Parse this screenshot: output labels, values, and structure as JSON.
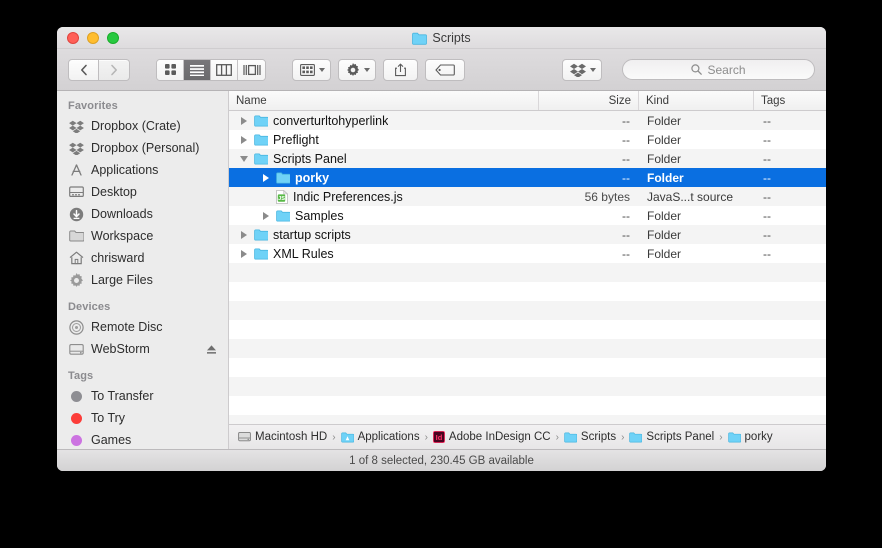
{
  "window": {
    "title": "Scripts",
    "title_icon": "folder-icon",
    "traffic_lights": [
      "close-button",
      "minimize-button",
      "maximize-button"
    ]
  },
  "toolbar": {
    "back_label": "‹",
    "forward_label": "›",
    "view_modes": [
      {
        "name": "icon-view",
        "active": false
      },
      {
        "name": "list-view",
        "active": true
      },
      {
        "name": "column-view",
        "active": false
      },
      {
        "name": "gallery-view",
        "active": false
      }
    ],
    "arrange_button": "arrange-button",
    "action_button": "action-gear-button",
    "share_button": "share-button",
    "tag_button": "tag-button",
    "dropbox_button": "dropbox-button",
    "search": {
      "placeholder": "Search",
      "value": ""
    }
  },
  "sidebar": {
    "sections": [
      {
        "header": "Favorites",
        "items": [
          {
            "label": "Dropbox (Crate)",
            "icon": "dropbox-icon"
          },
          {
            "label": "Dropbox (Personal)",
            "icon": "dropbox-icon"
          },
          {
            "label": "Applications",
            "icon": "applications-icon"
          },
          {
            "label": "Desktop",
            "icon": "desktop-icon"
          },
          {
            "label": "Downloads",
            "icon": "downloads-icon"
          },
          {
            "label": "Workspace",
            "icon": "folder-icon"
          },
          {
            "label": "chrisward",
            "icon": "home-icon"
          },
          {
            "label": "Large Files",
            "icon": "gear-icon"
          }
        ]
      },
      {
        "header": "Devices",
        "items": [
          {
            "label": "Remote Disc",
            "icon": "disc-icon"
          },
          {
            "label": "WebStorm",
            "icon": "drive-icon",
            "eject": true
          }
        ]
      },
      {
        "header": "Tags",
        "items": [
          {
            "label": "To Transfer",
            "icon": "tag-dot",
            "color": "#8e8e93"
          },
          {
            "label": "To Try",
            "icon": "tag-dot",
            "color": "#fc3d39"
          },
          {
            "label": "Games",
            "icon": "tag-dot",
            "color": "#cc73e1"
          }
        ]
      }
    ]
  },
  "file_list": {
    "columns": [
      "Name",
      "Size",
      "Kind",
      "Tags"
    ],
    "rows": [
      {
        "name": "converturltohyperlink",
        "size": "--",
        "kind": "Folder",
        "tags": "--",
        "depth": 0,
        "icon": "folder-icon",
        "twisty": "closed",
        "selected": false
      },
      {
        "name": "Preflight",
        "size": "--",
        "kind": "Folder",
        "tags": "--",
        "depth": 0,
        "icon": "folder-icon",
        "twisty": "closed",
        "selected": false
      },
      {
        "name": "Scripts Panel",
        "size": "--",
        "kind": "Folder",
        "tags": "--",
        "depth": 0,
        "icon": "folder-icon",
        "twisty": "open",
        "selected": false
      },
      {
        "name": "porky",
        "size": "--",
        "kind": "Folder",
        "tags": "--",
        "depth": 1,
        "icon": "folder-icon",
        "twisty": "closed",
        "selected": true
      },
      {
        "name": "Indic Preferences.js",
        "size": "56 bytes",
        "kind": "JavaS...t source",
        "tags": "--",
        "depth": 1,
        "icon": "javascript-file-icon",
        "twisty": "none",
        "selected": false
      },
      {
        "name": "Samples",
        "size": "--",
        "kind": "Folder",
        "tags": "--",
        "depth": 1,
        "icon": "folder-icon",
        "twisty": "closed",
        "selected": false
      },
      {
        "name": "startup scripts",
        "size": "--",
        "kind": "Folder",
        "tags": "--",
        "depth": 0,
        "icon": "folder-icon",
        "twisty": "closed",
        "selected": false
      },
      {
        "name": "XML Rules",
        "size": "--",
        "kind": "Folder",
        "tags": "--",
        "depth": 0,
        "icon": "folder-icon",
        "twisty": "closed",
        "selected": false
      }
    ],
    "empty_row_count": 10
  },
  "path_bar": {
    "items": [
      {
        "label": "Macintosh HD",
        "icon": "harddrive-icon"
      },
      {
        "label": "Applications",
        "icon": "applications-folder-icon"
      },
      {
        "label": "Adobe InDesign CC",
        "icon": "indesign-icon"
      },
      {
        "label": "Scripts",
        "icon": "folder-icon"
      },
      {
        "label": "Scripts Panel",
        "icon": "folder-icon"
      },
      {
        "label": "porky",
        "icon": "folder-icon"
      }
    ],
    "separator": "›"
  },
  "status": {
    "text": "1 of 8 selected, 230.45 GB available"
  },
  "colors": {
    "selection_blue": "#0a6fe1",
    "folder_blue": "#6fd2f7",
    "stripe_gray": "#f4f4f4",
    "sidebar_bg": "#ececec"
  }
}
